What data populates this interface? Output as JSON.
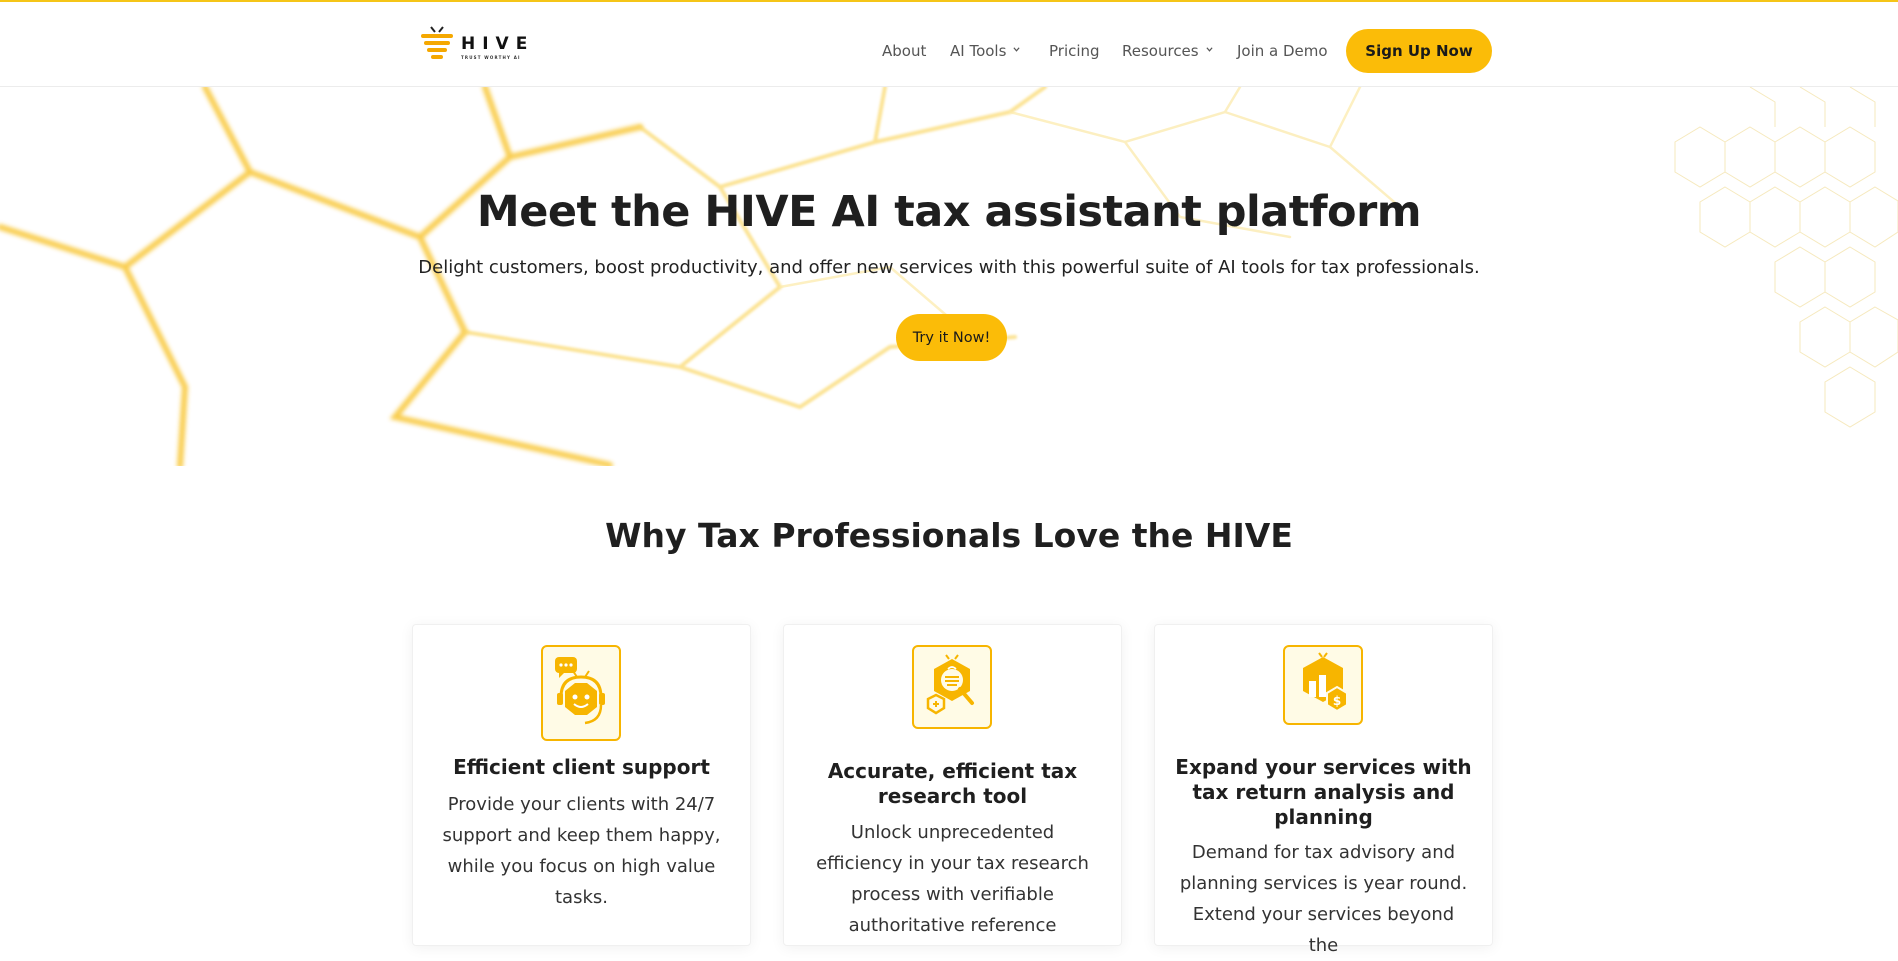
{
  "brand": {
    "name": "HIVE",
    "tagline": "TRUST WORTHY AI",
    "accent": "#fbbc08",
    "text_color": "#1f1f1f"
  },
  "nav": {
    "items": [
      {
        "label": "About",
        "has_dropdown": false
      },
      {
        "label": "AI Tools",
        "has_dropdown": true
      },
      {
        "label": "Pricing",
        "has_dropdown": false
      },
      {
        "label": "Resources",
        "has_dropdown": true
      },
      {
        "label": "Join a Demo",
        "has_dropdown": false
      }
    ],
    "cta_label": "Sign Up Now"
  },
  "hero": {
    "title": "Meet the HIVE AI tax assistant platform",
    "subtitle": "Delight customers, boost productivity, and offer new services with this powerful suite of AI tools for tax professionals.",
    "button_label": "Try it Now!"
  },
  "features": {
    "title": "Why Tax Professionals Love the HIVE",
    "cards": [
      {
        "icon": "chatbot-support-icon",
        "title": "Efficient client support",
        "text": "Provide your clients with 24/7 support and keep them happy, while you focus on high value tasks."
      },
      {
        "icon": "research-magnifier-icon",
        "title": "Accurate, efficient tax research tool",
        "text": "Unlock unprecedented efficiency in your tax research process with verifiable authoritative reference"
      },
      {
        "icon": "tax-planning-chart-icon",
        "title": "Expand your services with tax return analysis and planning",
        "text": "Demand for tax advisory and planning services is year round. Extend your services beyond the"
      }
    ]
  }
}
